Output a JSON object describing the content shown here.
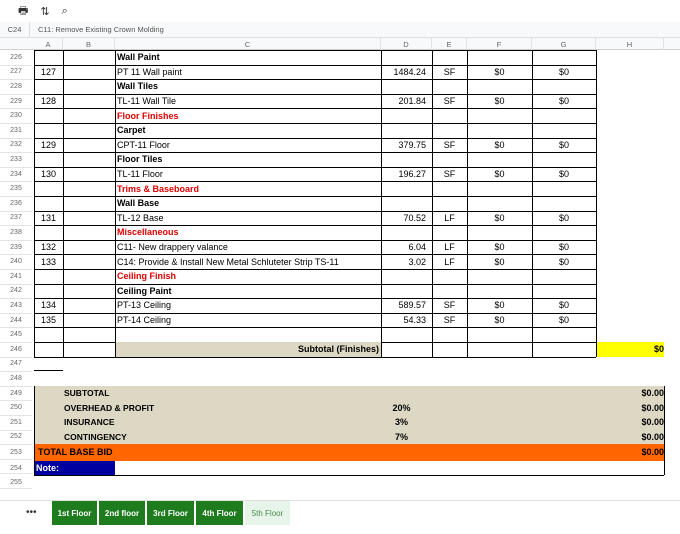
{
  "toolbar": {
    "print_icon": "printer-icon",
    "sort_icon": "sort-icon",
    "search_icon": "search-icon",
    "print_glyph": "🖶",
    "sort_glyph": "⇅",
    "search_glyph": "⌕"
  },
  "formula_bar": {
    "cell_ref": "C24",
    "content": "C11: Remove Existing Crown Molding"
  },
  "columns": [
    "A",
    "B",
    "C",
    "D",
    "E",
    "F",
    "G",
    "H"
  ],
  "rows": [
    {
      "num": "226",
      "a": "",
      "c": "Wall Paint",
      "style": "bold"
    },
    {
      "num": "227",
      "a": "127",
      "c": "PT 11 Wall paint",
      "d": "1484.24",
      "e": "SF",
      "f": "$0",
      "g": "$0"
    },
    {
      "num": "228",
      "a": "",
      "c": "Wall Tiles",
      "style": "bold"
    },
    {
      "num": "229",
      "a": "128",
      "c": "TL-11 Wall Tile",
      "d": "201.84",
      "e": "SF",
      "f": "$0",
      "g": "$0"
    },
    {
      "num": "230",
      "a": "",
      "c": "Floor Finishes",
      "style": "red"
    },
    {
      "num": "231",
      "a": "",
      "c": "Carpet",
      "style": "bold"
    },
    {
      "num": "232",
      "a": "129",
      "c": "CPT-11 Floor",
      "d": "379.75",
      "e": "SF",
      "f": "$0",
      "g": "$0"
    },
    {
      "num": "233",
      "a": "",
      "c": "Floor Tiles",
      "style": "bold"
    },
    {
      "num": "234",
      "a": "130",
      "c": "TL-11 Floor",
      "d": "196.27",
      "e": "SF",
      "f": "$0",
      "g": "$0"
    },
    {
      "num": "235",
      "a": "",
      "c": "Trims & Baseboard",
      "style": "red"
    },
    {
      "num": "236",
      "a": "",
      "c": "Wall Base",
      "style": "bold"
    },
    {
      "num": "237",
      "a": "131",
      "c": "TL-12 Base",
      "d": "70.52",
      "e": "LF",
      "f": "$0",
      "g": "$0"
    },
    {
      "num": "238",
      "a": "",
      "c": "Miscellaneous",
      "style": "red"
    },
    {
      "num": "239",
      "a": "132",
      "c": "C11- New drappery valance",
      "d": "6.04",
      "e": "LF",
      "f": "$0",
      "g": "$0"
    },
    {
      "num": "240",
      "a": "133",
      "c": "C14: Provide & Install New Metal Schluteter Strip TS-11",
      "d": "3.02",
      "e": "LF",
      "f": "$0",
      "g": "$0"
    },
    {
      "num": "241",
      "a": "",
      "c": "Ceiling Finish",
      "style": "red"
    },
    {
      "num": "242",
      "a": "",
      "c": "Ceiling Paint",
      "style": "bold"
    },
    {
      "num": "243",
      "a": "134",
      "c": "PT-13 Ceiling",
      "d": "589.57",
      "e": "SF",
      "f": "$0",
      "g": "$0"
    },
    {
      "num": "244",
      "a": "135",
      "c": "PT-14 Ceiling",
      "d": "54.33",
      "e": "SF",
      "f": "$0",
      "g": "$0"
    },
    {
      "num": "245",
      "a": "",
      "c": ""
    }
  ],
  "subtotal_row": {
    "num": "246",
    "label": "Subtotal (Finishes)",
    "value": "$0"
  },
  "empty_rows": [
    "247",
    "248"
  ],
  "summary": [
    {
      "num": "249",
      "label": "SUBTOTAL",
      "pct": "",
      "value": "$0.00"
    },
    {
      "num": "250",
      "label": "OVERHEAD & PROFIT",
      "pct": "20%",
      "value": "$0.00"
    },
    {
      "num": "251",
      "label": "INSURANCE",
      "pct": "3%",
      "value": "$0.00"
    },
    {
      "num": "252",
      "label": "CONTINGENCY",
      "pct": "7%",
      "value": "$0.00"
    }
  ],
  "total": {
    "num": "253",
    "label": "TOTAL BASE BID",
    "value": "$0.00"
  },
  "note": {
    "num": "254",
    "label": "Note:"
  },
  "last_row": "255",
  "tabs": [
    {
      "label": "1st Floor",
      "active": true
    },
    {
      "label": "2nd floor",
      "active": true
    },
    {
      "label": "3rd Floor",
      "active": true
    },
    {
      "label": "4th Floor",
      "active": true
    },
    {
      "label": "5th Floor",
      "active": false
    }
  ],
  "tabs_menu_label": "•••",
  "colors": {
    "red": "#e00000",
    "green_tab": "#1e7b1e",
    "yellow": "#ffff00",
    "beige": "#ddd8c4",
    "orange": "#ff6600",
    "navy": "#0000a0"
  }
}
